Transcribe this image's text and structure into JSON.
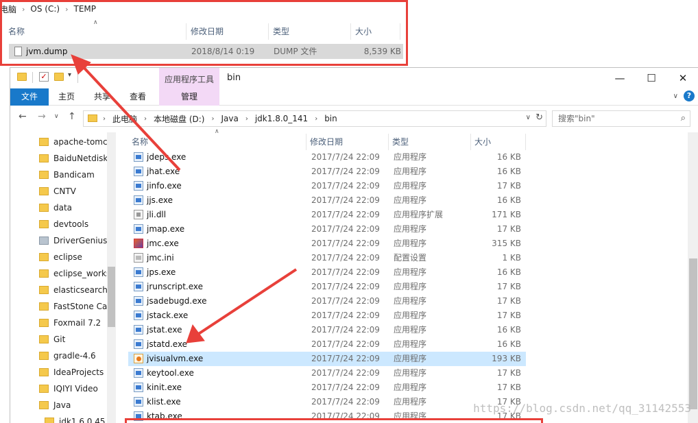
{
  "top_window": {
    "breadcrumb": [
      "电脑",
      "OS (C:)",
      "TEMP"
    ],
    "columns": [
      "名称",
      "修改日期",
      "类型",
      "大小"
    ],
    "file": {
      "name": "jvm.dump",
      "date": "2018/8/14 0:19",
      "type": "DUMP 文件",
      "size": "8,539 KB"
    }
  },
  "window": {
    "title": "bin",
    "context_tab_group": "应用程序工具",
    "ribbon_tabs": {
      "file": "文件",
      "home": "主页",
      "share": "共享",
      "view": "查看",
      "manage": "管理"
    },
    "controls": {
      "minimize": "—",
      "maximize": "☐",
      "close": "✕"
    },
    "help": "?",
    "address": [
      "此电脑",
      "本地磁盘 (D:)",
      "Java",
      "jdk1.8.0_141",
      "bin"
    ],
    "search_placeholder": "搜索\"bin\"",
    "nav_items": [
      "apache-tomca",
      "BaiduNetdisk",
      "Bandicam",
      "CNTV",
      "data",
      "devtools",
      "DriverGenius",
      "eclipse",
      "eclipse_works",
      "elasticsearch-",
      "FastStone Cap",
      "Foxmail 7.2",
      "Git",
      "gradle-4.6",
      "IdeaProjects",
      "IQIYI Video",
      "Java",
      "jdk1.6.0 45"
    ],
    "columns": [
      "名称",
      "修改日期",
      "类型",
      "大小"
    ],
    "files": [
      {
        "name": "jdeps.exe",
        "date": "2017/7/24 22:09",
        "type": "应用程序",
        "size": "16 KB",
        "icon": "exe"
      },
      {
        "name": "jhat.exe",
        "date": "2017/7/24 22:09",
        "type": "应用程序",
        "size": "16 KB",
        "icon": "exe"
      },
      {
        "name": "jinfo.exe",
        "date": "2017/7/24 22:09",
        "type": "应用程序",
        "size": "17 KB",
        "icon": "exe"
      },
      {
        "name": "jjs.exe",
        "date": "2017/7/24 22:09",
        "type": "应用程序",
        "size": "16 KB",
        "icon": "exe"
      },
      {
        "name": "jli.dll",
        "date": "2017/7/24 22:09",
        "type": "应用程序扩展",
        "size": "171 KB",
        "icon": "dll"
      },
      {
        "name": "jmap.exe",
        "date": "2017/7/24 22:09",
        "type": "应用程序",
        "size": "17 KB",
        "icon": "exe"
      },
      {
        "name": "jmc.exe",
        "date": "2017/7/24 22:09",
        "type": "应用程序",
        "size": "315 KB",
        "icon": "jmc"
      },
      {
        "name": "jmc.ini",
        "date": "2017/7/24 22:09",
        "type": "配置设置",
        "size": "1 KB",
        "icon": "ini"
      },
      {
        "name": "jps.exe",
        "date": "2017/7/24 22:09",
        "type": "应用程序",
        "size": "16 KB",
        "icon": "exe"
      },
      {
        "name": "jrunscript.exe",
        "date": "2017/7/24 22:09",
        "type": "应用程序",
        "size": "17 KB",
        "icon": "exe"
      },
      {
        "name": "jsadebugd.exe",
        "date": "2017/7/24 22:09",
        "type": "应用程序",
        "size": "17 KB",
        "icon": "exe"
      },
      {
        "name": "jstack.exe",
        "date": "2017/7/24 22:09",
        "type": "应用程序",
        "size": "17 KB",
        "icon": "exe"
      },
      {
        "name": "jstat.exe",
        "date": "2017/7/24 22:09",
        "type": "应用程序",
        "size": "16 KB",
        "icon": "exe"
      },
      {
        "name": "jstatd.exe",
        "date": "2017/7/24 22:09",
        "type": "应用程序",
        "size": "16 KB",
        "icon": "exe"
      },
      {
        "name": "jvisualvm.exe",
        "date": "2017/7/24 22:09",
        "type": "应用程序",
        "size": "193 KB",
        "icon": "jvis",
        "selected": true
      },
      {
        "name": "keytool.exe",
        "date": "2017/7/24 22:09",
        "type": "应用程序",
        "size": "17 KB",
        "icon": "exe"
      },
      {
        "name": "kinit.exe",
        "date": "2017/7/24 22:09",
        "type": "应用程序",
        "size": "17 KB",
        "icon": "exe"
      },
      {
        "name": "klist.exe",
        "date": "2017/7/24 22:09",
        "type": "应用程序",
        "size": "17 KB",
        "icon": "exe"
      },
      {
        "name": "ktab.exe",
        "date": "2017/7/24 22:09",
        "type": "应用程序",
        "size": "17 KB",
        "icon": "exe"
      }
    ]
  },
  "watermark": "https://blog.csdn.net/qq_31142553",
  "colors": {
    "annotation": "#e8403a",
    "file_tab": "#1979ca",
    "context_tab": "#f3d9f6",
    "selection": "#cce8ff"
  }
}
